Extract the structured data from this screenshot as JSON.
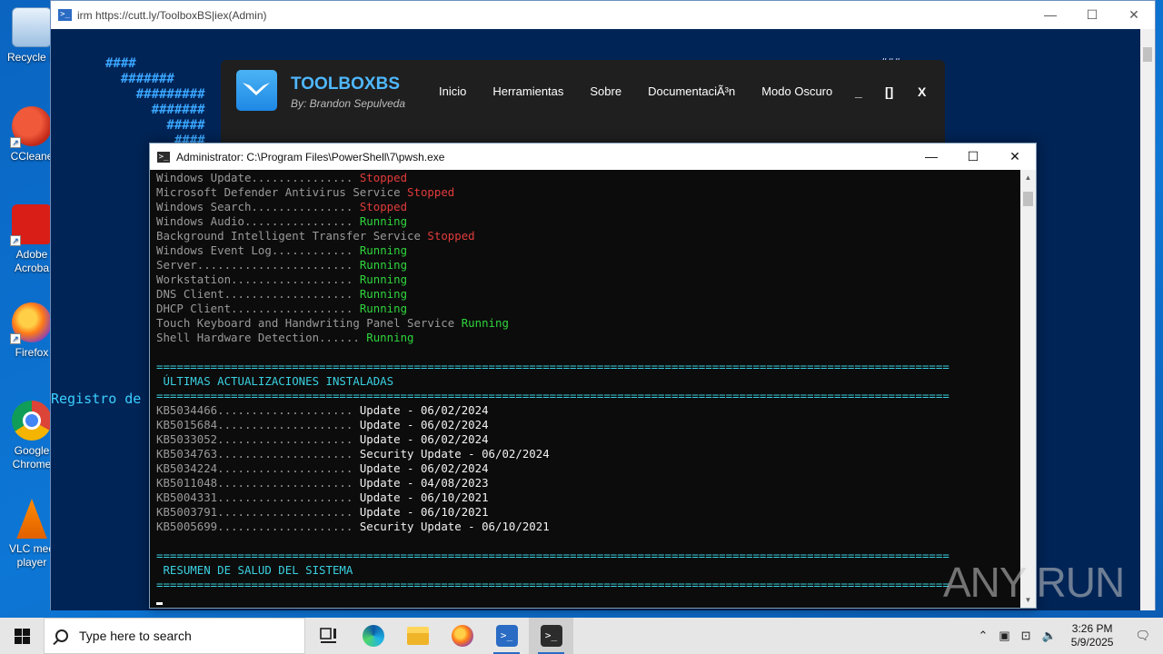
{
  "desktop": {
    "icons": [
      {
        "label": "Recycle B",
        "icon": "recycle-bin-icon"
      },
      {
        "label": "CCleane",
        "icon": "ccleaner-icon"
      },
      {
        "label": "Adobe Acroba",
        "icon": "adobe-acrobat-icon"
      },
      {
        "label": "Firefox",
        "icon": "firefox-icon"
      },
      {
        "label": "Google Chrome",
        "icon": "chrome-icon"
      },
      {
        "label": "VLC med player",
        "icon": "vlc-icon"
      }
    ]
  },
  "bg_window": {
    "title": "irm https://cutt.ly/ToolboxBS|iex(Admin)",
    "ascii_lines": [
      "####",
      "  #######",
      "    #########",
      "      #######",
      "        #####",
      "         ####"
    ],
    "registro_text": "Registro de",
    "hash_right": "###"
  },
  "toolbox": {
    "brand": "TOOLBOXBS",
    "byline": "By: Brandon Sepulveda",
    "nav": [
      "Inicio",
      "Herramientas",
      "Sobre",
      "DocumentaciÃ³n",
      "Modo Oscuro"
    ],
    "controls": {
      "minimize": "_",
      "maximize": "[]",
      "close": "X"
    }
  },
  "pwsh_window": {
    "title": "Administrator: C:\\Program Files\\PowerShell\\7\\pwsh.exe",
    "services": [
      {
        "name": "Windows Update...............",
        "status": "Stopped",
        "color": "red"
      },
      {
        "name": "Microsoft Defender Antivirus Service",
        "status": "Stopped",
        "color": "red"
      },
      {
        "name": "Windows Search...............",
        "status": "Stopped",
        "color": "red"
      },
      {
        "name": "Windows Audio................",
        "status": "Running",
        "color": "green"
      },
      {
        "name": "Background Intelligent Transfer Service",
        "status": "Stopped",
        "color": "red"
      },
      {
        "name": "Windows Event Log............",
        "status": "Running",
        "color": "green"
      },
      {
        "name": "Server.......................",
        "status": "Running",
        "color": "green"
      },
      {
        "name": "Workstation..................",
        "status": "Running",
        "color": "green"
      },
      {
        "name": "DNS Client...................",
        "status": "Running",
        "color": "green"
      },
      {
        "name": "DHCP Client..................",
        "status": "Running",
        "color": "green"
      },
      {
        "name": "Touch Keyboard and Handwriting Panel Service",
        "status": "Running",
        "color": "green"
      },
      {
        "name": "Shell Hardware Detection......",
        "status": "Running",
        "color": "green"
      }
    ],
    "separator": "=====================================================================================================================",
    "section_updates": " ÚLTIMAS ACTUALIZACIONES INSTALADAS",
    "updates": [
      {
        "kb": "KB5034466....................",
        "desc": "Update - 06/02/2024"
      },
      {
        "kb": "KB5015684....................",
        "desc": "Update - 06/02/2024"
      },
      {
        "kb": "KB5033052....................",
        "desc": "Update - 06/02/2024"
      },
      {
        "kb": "KB5034763....................",
        "desc": "Security Update - 06/02/2024"
      },
      {
        "kb": "KB5034224....................",
        "desc": "Update - 06/02/2024"
      },
      {
        "kb": "KB5011048....................",
        "desc": "Update - 04/08/2023"
      },
      {
        "kb": "KB5004331....................",
        "desc": "Update - 06/10/2021"
      },
      {
        "kb": "KB5003791....................",
        "desc": "Update - 06/10/2021"
      },
      {
        "kb": "KB5005699....................",
        "desc": "Security Update - 06/10/2021"
      }
    ],
    "section_health": " RESUMEN DE SALUD DEL SISTEMA"
  },
  "watermark": "ANY RUN",
  "taskbar": {
    "search_placeholder": "Type here to search",
    "apps": [
      "task-view-icon",
      "edge-icon",
      "file-explorer-icon",
      "firefox-icon",
      "powershell-icon",
      "pwsh-icon"
    ],
    "time": "3:26 PM",
    "date": "5/9/2025"
  },
  "colors": {
    "desktop": "#0d77d6",
    "console_bg": "#0c0c0c",
    "stopped": "#e23b3b",
    "running": "#2fd53c",
    "heading": "#3ad0e0",
    "toolbox_bg": "#1f1f1f",
    "brand": "#4fb8ff"
  }
}
